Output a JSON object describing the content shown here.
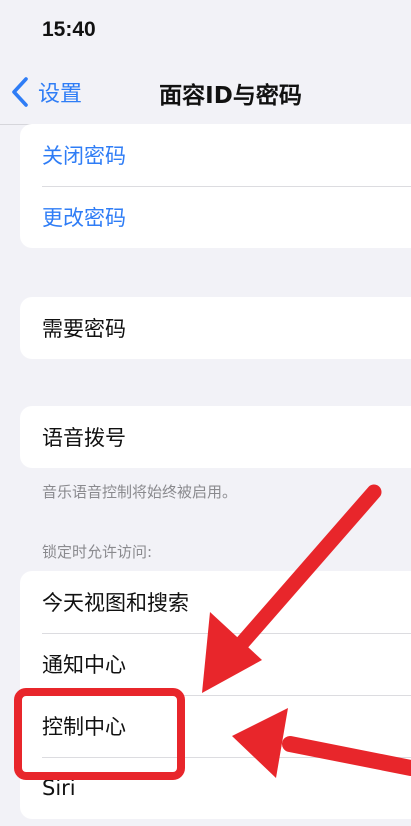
{
  "status_bar": {
    "time": "15:40"
  },
  "nav": {
    "back_label": "设置",
    "title": "面容ID与密码"
  },
  "groups": {
    "passcode": {
      "items": [
        {
          "label": "关闭密码"
        },
        {
          "label": "更改密码"
        }
      ]
    },
    "require": {
      "items": [
        {
          "label": "需要密码"
        }
      ]
    },
    "voice": {
      "items": [
        {
          "label": "语音拨号"
        }
      ],
      "footnote": "音乐语音控制将始终被启用。"
    },
    "locked": {
      "header": "锁定时允许访问:",
      "items": [
        {
          "label": "今天视图和搜索"
        },
        {
          "label": "通知中心"
        },
        {
          "label": "控制中心"
        },
        {
          "label": "Siri"
        }
      ]
    }
  },
  "annotations": {
    "highlight_color": "#e8262b",
    "highlighted_item": "控制中心"
  },
  "colors": {
    "accent": "#2f7df6",
    "background": "#f2f2f7",
    "cell": "#ffffff",
    "secondary_text": "#8a8a8e"
  },
  "icons": [
    "chevron-left-icon",
    "arrow-annotation-icon",
    "baidu-paw-icon"
  ]
}
